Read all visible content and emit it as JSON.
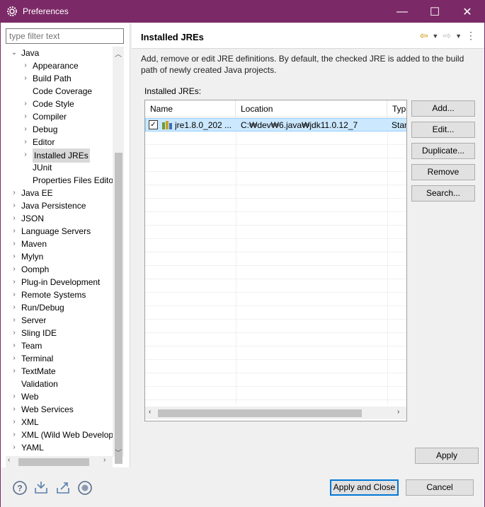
{
  "window": {
    "title": "Preferences",
    "minimize": "—",
    "maximize": "☐",
    "close": "✕"
  },
  "filter": {
    "placeholder": "type filter text"
  },
  "tree": {
    "items": [
      {
        "label": "Java",
        "chev": "⌄"
      },
      {
        "label": "Appearance",
        "chev": "›"
      },
      {
        "label": "Build Path",
        "chev": "›"
      },
      {
        "label": "Code Coverage",
        "chev": ""
      },
      {
        "label": "Code Style",
        "chev": "›"
      },
      {
        "label": "Compiler",
        "chev": "›"
      },
      {
        "label": "Debug",
        "chev": "›"
      },
      {
        "label": "Editor",
        "chev": "›"
      },
      {
        "label": "Installed JREs",
        "chev": "›"
      },
      {
        "label": "JUnit",
        "chev": ""
      },
      {
        "label": "Properties Files Editor",
        "chev": ""
      },
      {
        "label": "Java EE",
        "chev": "›"
      },
      {
        "label": "Java Persistence",
        "chev": "›"
      },
      {
        "label": "JSON",
        "chev": "›"
      },
      {
        "label": "Language Servers",
        "chev": "›"
      },
      {
        "label": "Maven",
        "chev": "›"
      },
      {
        "label": "Mylyn",
        "chev": "›"
      },
      {
        "label": "Oomph",
        "chev": "›"
      },
      {
        "label": "Plug-in Development",
        "chev": "›"
      },
      {
        "label": "Remote Systems",
        "chev": "›"
      },
      {
        "label": "Run/Debug",
        "chev": "›"
      },
      {
        "label": "Server",
        "chev": "›"
      },
      {
        "label": "Sling IDE",
        "chev": "›"
      },
      {
        "label": "Team",
        "chev": "›"
      },
      {
        "label": "Terminal",
        "chev": "›"
      },
      {
        "label": "TextMate",
        "chev": "›"
      },
      {
        "label": "Validation",
        "chev": ""
      },
      {
        "label": "Web",
        "chev": "›"
      },
      {
        "label": "Web Services",
        "chev": "›"
      },
      {
        "label": "XML",
        "chev": "›"
      },
      {
        "label": "XML (Wild Web Developer)",
        "chev": "›"
      },
      {
        "label": "YAML",
        "chev": "›"
      }
    ]
  },
  "page": {
    "title": "Installed JREs",
    "description": "Add, remove or edit JRE definitions. By default, the checked JRE is added to the build path of newly created Java projects.",
    "table_label": "Installed JREs:"
  },
  "table": {
    "columns": [
      "Name",
      "Location",
      "Type"
    ],
    "rows": [
      {
        "name": "jre1.8.0_202 ...",
        "location": "C:₩dev₩6.java₩jdk11.0.12_7",
        "type": "Standard VM",
        "checked": "✓"
      }
    ]
  },
  "buttons": {
    "add": "Add...",
    "edit": "Edit...",
    "duplicate": "Duplicate...",
    "remove": "Remove",
    "search": "Search...",
    "apply": "Apply",
    "apply_close": "Apply and Close",
    "cancel": "Cancel"
  },
  "colors": {
    "titlebar": "#7c2a67",
    "selection": "#cce8ff",
    "accent": "#0078d7"
  }
}
